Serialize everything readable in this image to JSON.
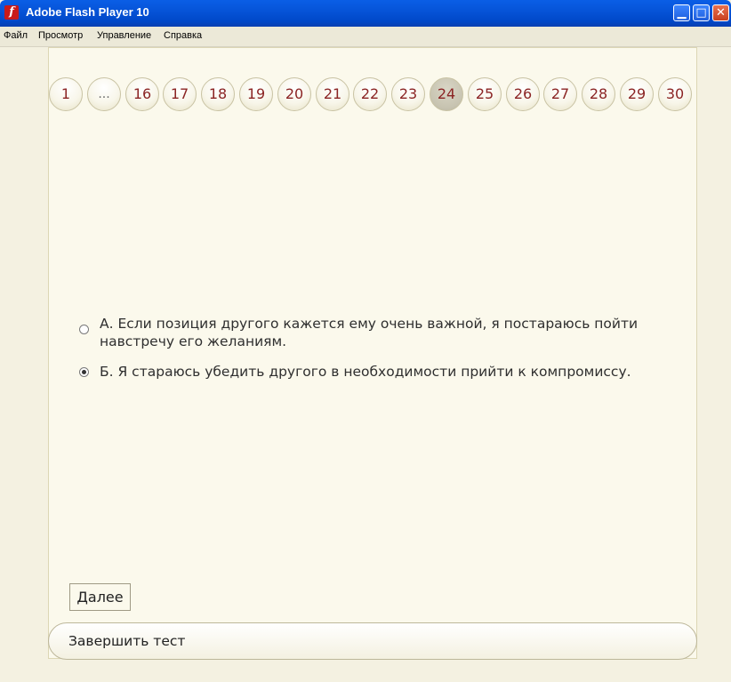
{
  "window": {
    "title": "Adobe Flash Player 10",
    "controls": [
      "minimize",
      "maximize",
      "close"
    ]
  },
  "menu": [
    "Файл",
    "Просмотр",
    "Управление",
    "Справка"
  ],
  "pagination": {
    "items": [
      "1",
      "...",
      "16",
      "17",
      "18",
      "19",
      "20",
      "21",
      "22",
      "23",
      "24",
      "25",
      "26",
      "27",
      "28",
      "29",
      "30"
    ],
    "active": "24"
  },
  "question": {
    "options": [
      {
        "text": "А. Если позиция другого кажется ему очень важной, я постараюсь пойти навстречу его желаниям.",
        "selected": false
      },
      {
        "text": "Б. Я стараюсь убедить другого в необходимости прийти к компромиссу.",
        "selected": true
      }
    ]
  },
  "next_label": "Далее",
  "finish_label": "Завершить тест",
  "colors": {
    "page_number": "#8b2424",
    "background": "#f4f1e1",
    "titlebar": "#0654d8"
  }
}
